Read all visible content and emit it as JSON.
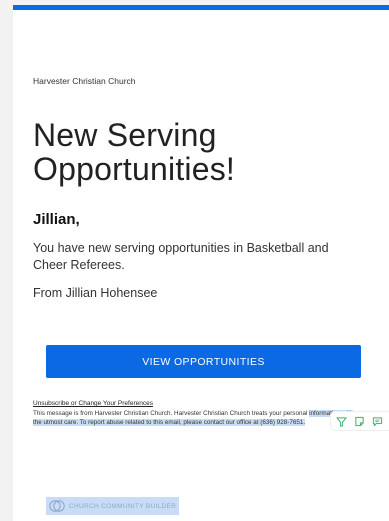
{
  "email": {
    "church_name": "Harvester Christian Church",
    "headline_line1": "New Serving",
    "headline_line2": "Opportunities!",
    "greeting": "Jillian,",
    "message": "You have new serving opportunities in Basketball and Cheer Referees.",
    "signature": "From Jillian Hohensee",
    "cta_label": "VIEW OPPORTUNITIES",
    "unsubscribe_label": "Unsubscribe or Change Your Preferences",
    "disclaimer_part1": "This message is from Harvester Christian Church. Harvester Christian Church treats your personal",
    "disclaimer_part2": "information with the utmost care. To report abuse related to this email, please contact our office at (636) 928-7651.",
    "footer_brand": "CHURCH COMMUNITY BUILDER"
  },
  "toolbar": {
    "icons": [
      "highlighter-icon",
      "note-icon",
      "comment-icon",
      "check-icon"
    ]
  },
  "colors": {
    "accent": "#0b69e3",
    "selection": "#c9dcf7",
    "toolbar_icon": "#3bb36b"
  }
}
